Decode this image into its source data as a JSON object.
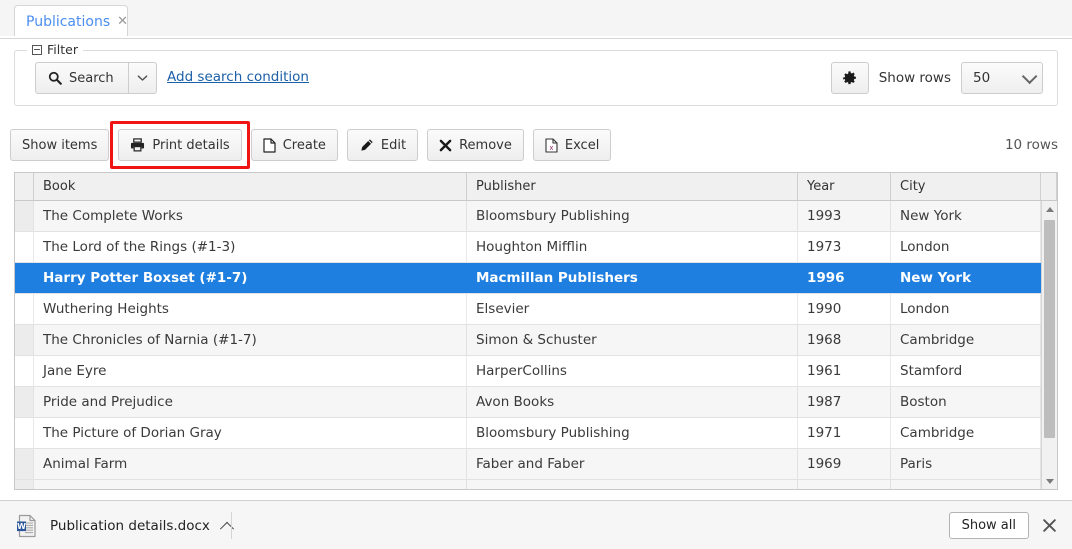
{
  "tab": {
    "label": "Publications",
    "close_icon": "close-icon"
  },
  "filter": {
    "legend": "Filter",
    "search_label": "Search",
    "search_icon": "search-icon",
    "dropdown_icon": "chevron-down-icon",
    "add_condition_label": "Add search condition",
    "settings_icon": "gear-icon",
    "show_rows_label": "Show rows",
    "rows_value": "50",
    "rows_caret_icon": "chevron-down-icon"
  },
  "toolbar": {
    "buttons": [
      {
        "label": "Show items",
        "icon": null,
        "highlighted": false
      },
      {
        "label": "Print details",
        "icon": "printer-icon",
        "highlighted": true
      },
      {
        "label": "Create",
        "icon": "document-icon",
        "highlighted": false
      },
      {
        "label": "Edit",
        "icon": "pencil-icon",
        "highlighted": false
      },
      {
        "label": "Remove",
        "icon": "cross-icon",
        "highlighted": false
      },
      {
        "label": "Excel",
        "icon": "excel-icon",
        "highlighted": false
      }
    ],
    "rows_count": "10 rows",
    "highlight_color": "#f01414"
  },
  "table": {
    "columns": [
      "Book",
      "Publisher",
      "Year",
      "City"
    ],
    "selection_color": "#1e7fe0",
    "rows": [
      {
        "book": "The Complete Works",
        "publisher": "Bloomsbury Publishing",
        "year": "1993",
        "city": "New York",
        "selected": false
      },
      {
        "book": "The Lord of the Rings (#1-3)",
        "publisher": "Houghton Mifflin",
        "year": "1973",
        "city": "London",
        "selected": false
      },
      {
        "book": "Harry Potter Boxset (#1-7)",
        "publisher": "Macmillan Publishers",
        "year": "1996",
        "city": "New York",
        "selected": true
      },
      {
        "book": "Wuthering Heights",
        "publisher": "Elsevier",
        "year": "1990",
        "city": "London",
        "selected": false
      },
      {
        "book": "The Chronicles of Narnia (#1-7)",
        "publisher": "Simon & Schuster",
        "year": "1968",
        "city": "Cambridge",
        "selected": false
      },
      {
        "book": "Jane Eyre",
        "publisher": "HarperCollins",
        "year": "1961",
        "city": "Stamford",
        "selected": false
      },
      {
        "book": "Pride and Prejudice",
        "publisher": "Avon Books",
        "year": "1987",
        "city": "Boston",
        "selected": false
      },
      {
        "book": "The Picture of Dorian Gray",
        "publisher": "Bloomsbury Publishing",
        "year": "1971",
        "city": "Cambridge",
        "selected": false
      },
      {
        "book": "Animal Farm",
        "publisher": "Faber and Faber",
        "year": "1969",
        "city": "Paris",
        "selected": false
      }
    ]
  },
  "download_shelf": {
    "file_name": "Publication details.docx",
    "file_icon": "word-document-icon",
    "menu_icon": "chevron-up-icon",
    "show_all_label": "Show all",
    "close_icon": "close-icon"
  }
}
